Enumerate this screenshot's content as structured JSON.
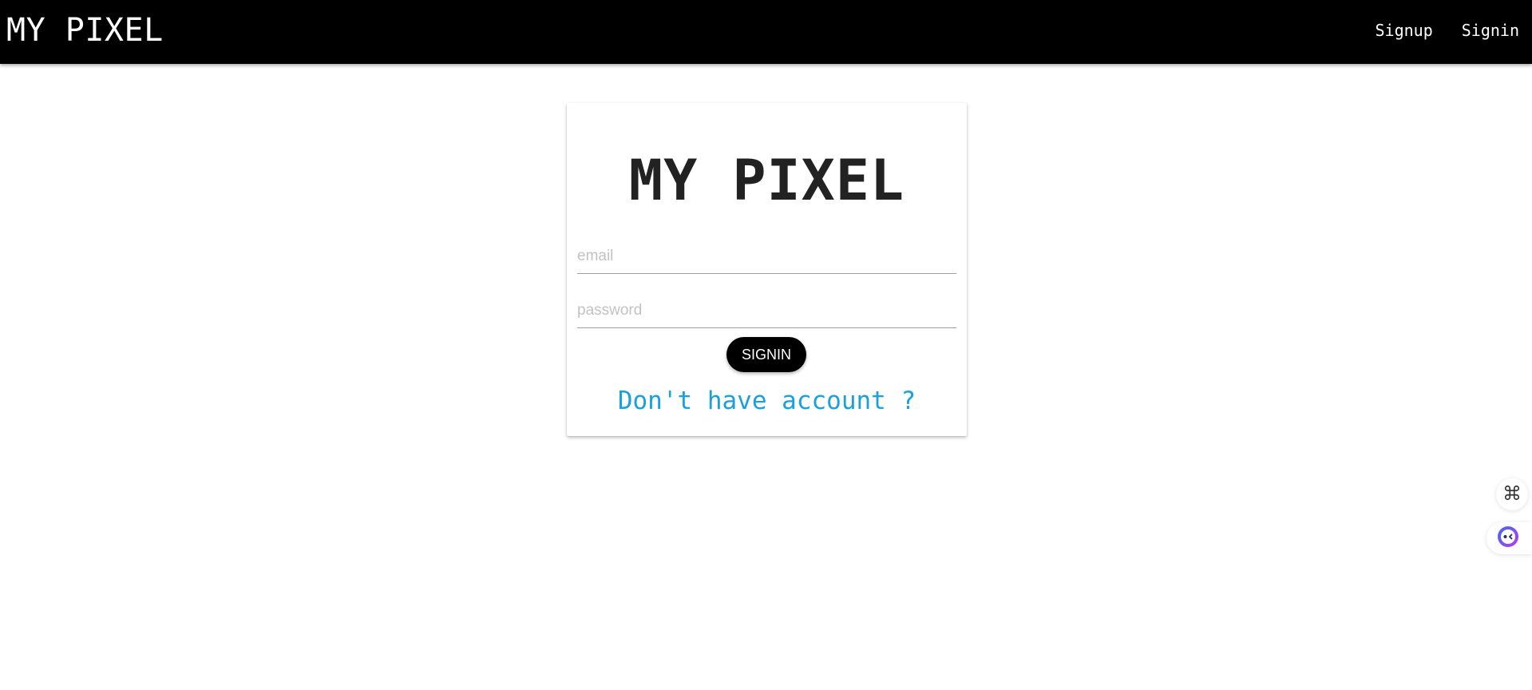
{
  "navbar": {
    "brand": "MY PIXEL",
    "links": [
      {
        "label": "Signup"
      },
      {
        "label": "Signin"
      }
    ]
  },
  "login_card": {
    "title": "MY PIXEL",
    "email_placeholder": "email",
    "email_value": "",
    "password_placeholder": "password",
    "password_value": "",
    "submit_label": "SIGNIN",
    "signup_link": "Don't have account ?"
  },
  "floating_widgets": {
    "command_icon": "command-icon",
    "assistant_icon": "assistant-bot-icon"
  },
  "colors": {
    "navbar_bg": "#000000",
    "link_accent": "#1aa0dc",
    "button_bg": "#000000",
    "text": "#222222"
  }
}
